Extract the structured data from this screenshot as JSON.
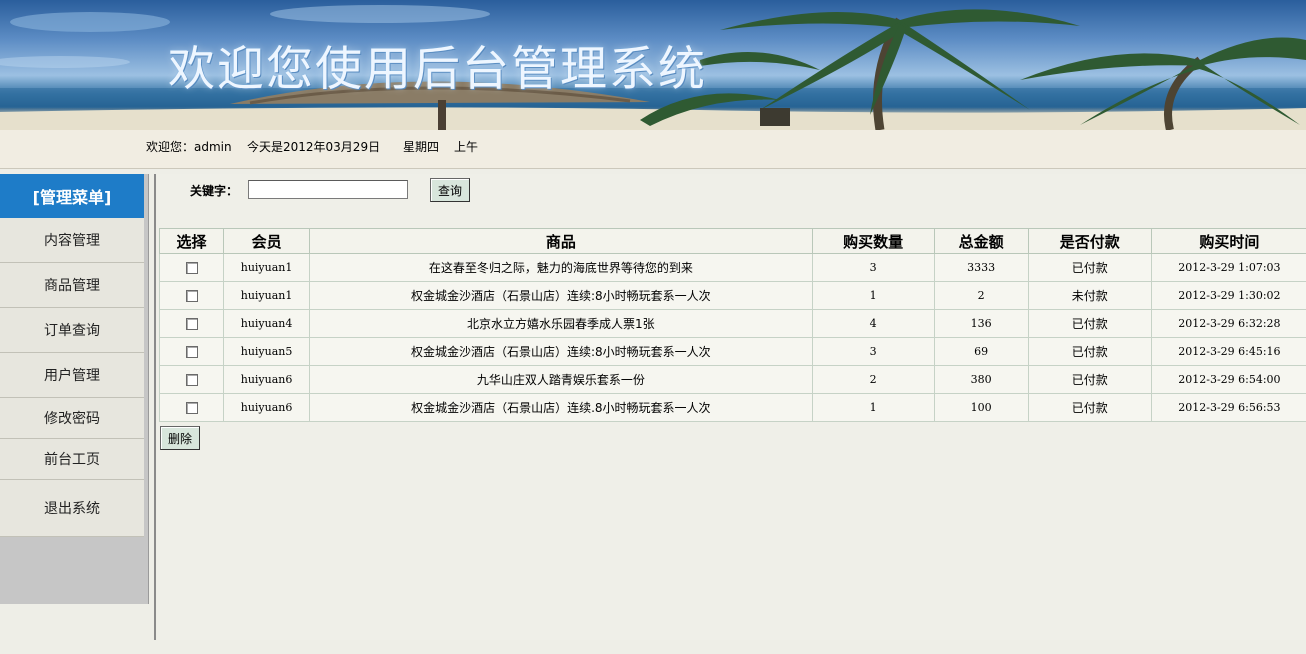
{
  "banner": {
    "title": "欢迎您使用后台管理系统"
  },
  "infobar": {
    "welcome": "欢迎您：admin",
    "date": "今天是2012年03月29日",
    "weekday": "星期四",
    "period": "上午"
  },
  "sidebar": {
    "header": "[管理菜单]",
    "items": [
      {
        "label": "内容管理"
      },
      {
        "label": "商品管理"
      },
      {
        "label": "订单查询"
      },
      {
        "label": "用户管理"
      },
      {
        "label": "修改密码"
      },
      {
        "label": "前台工页"
      },
      {
        "label": "退出系统"
      }
    ]
  },
  "search": {
    "label": "关键字：",
    "value": "",
    "button_label": "查询"
  },
  "table": {
    "headers": [
      "选择",
      "会员",
      "商品",
      "购买数量",
      "总金额",
      "是否付款",
      "购买时间"
    ],
    "rows": [
      {
        "member": "huiyuan1",
        "product": "在这春至冬归之际，魅力的海底世界等待您的到来",
        "qty": "3",
        "total": "3333",
        "paid": "已付款",
        "time": "2012-3-29 1:07:03"
      },
      {
        "member": "huiyuan1",
        "product": "权金城金沙酒店（石景山店）连续:8小时畅玩套系一人次",
        "qty": "1",
        "total": "2",
        "paid": "未付款",
        "time": "2012-3-29 1:30:02"
      },
      {
        "member": "huiyuan4",
        "product": "北京水立方嬉水乐园春季成人票1张",
        "qty": "4",
        "total": "136",
        "paid": "已付款",
        "time": "2012-3-29 6:32:28"
      },
      {
        "member": "huiyuan5",
        "product": "权金城金沙酒店（石景山店）连续:8小时畅玩套系一人次",
        "qty": "3",
        "total": "69",
        "paid": "已付款",
        "time": "2012-3-29 6:45:16"
      },
      {
        "member": "huiyuan6",
        "product": "九华山庄双人踏青娱乐套系一份",
        "qty": "2",
        "total": "380",
        "paid": "已付款",
        "time": "2012-3-29 6:54:00"
      },
      {
        "member": "huiyuan6",
        "product": "权金城金沙酒店（石景山店）连续.8小时畅玩套系一人次",
        "qty": "1",
        "total": "100",
        "paid": "已付款",
        "time": "2012-3-29 6:56:53"
      }
    ]
  },
  "actions": {
    "delete_label": "删除"
  },
  "colors": {
    "sidebar_header": "#1e7cc8",
    "page_bg": "#eeeee7",
    "sidebar_bg": "#c6c6c6"
  }
}
